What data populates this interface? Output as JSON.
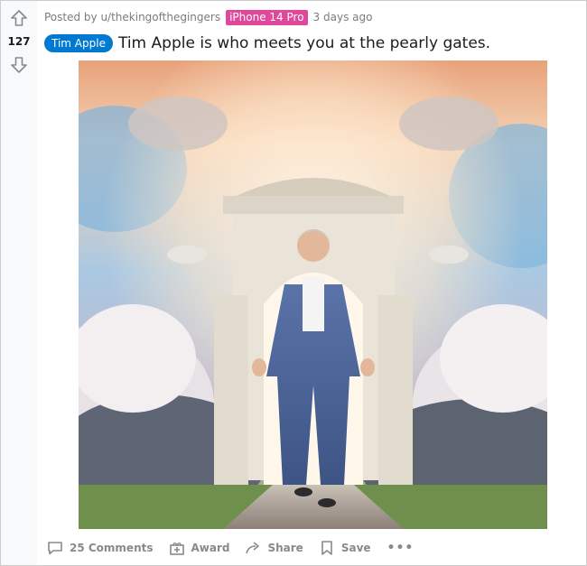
{
  "post": {
    "score": "127",
    "posted_by": "Posted by u/thekingofthegingers",
    "user_flair": "iPhone 14 Pro",
    "age": "3 days ago",
    "post_flair": "Tim Apple",
    "title": "Tim Apple is who meets you at the pearly gates."
  },
  "actions": {
    "comments_label": "25 Comments",
    "award_label": "Award",
    "share_label": "Share",
    "save_label": "Save",
    "more_label": "•••"
  },
  "icons": {
    "upvote": "arrow-up-outline-icon",
    "downvote": "arrow-down-outline-icon",
    "comments": "speech-bubble-icon",
    "award": "gift-box-icon",
    "share": "curved-arrow-icon",
    "save": "bookmark-icon"
  },
  "colors": {
    "device_flair_bg": "#e0489b",
    "post_flair_bg": "#0079d3",
    "muted_text": "#787c7e",
    "action_text": "#878a8c"
  }
}
